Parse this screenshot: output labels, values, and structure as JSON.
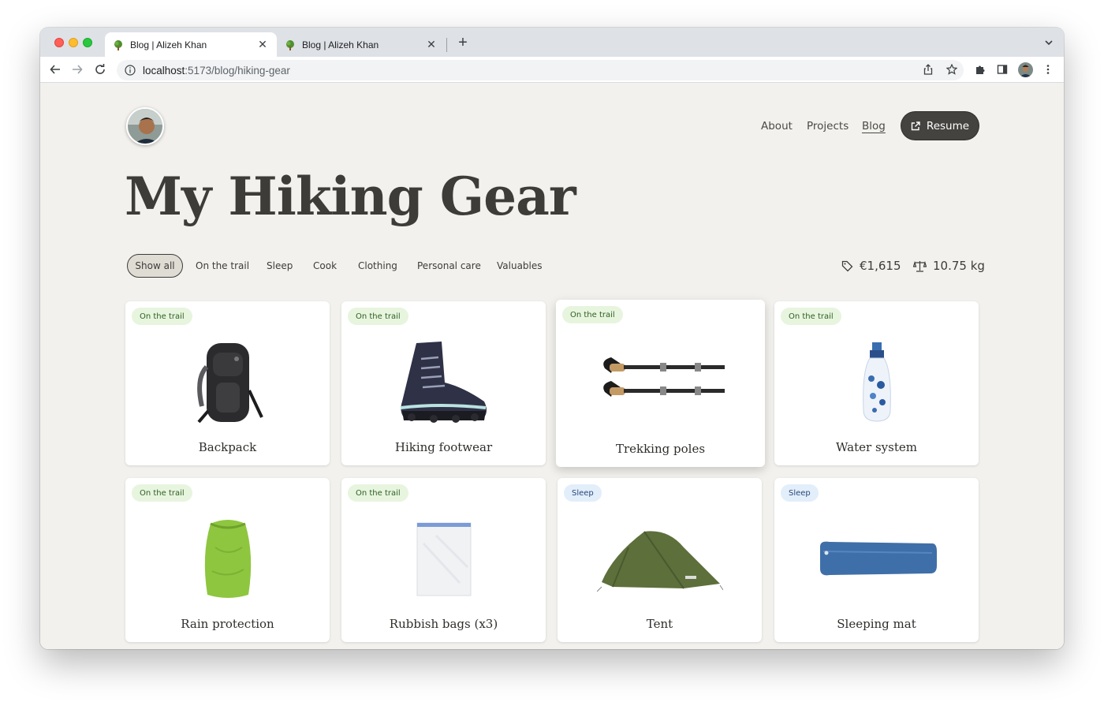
{
  "browser": {
    "tabs": [
      {
        "title": "Blog | Alizeh Khan",
        "active": true
      },
      {
        "title": "Blog | Alizeh Khan",
        "active": false
      }
    ],
    "url_host": "localhost",
    "url_path": ":5173/blog/hiking-gear"
  },
  "nav": {
    "items": [
      "About",
      "Projects",
      "Blog"
    ],
    "active": "Blog",
    "resume_label": "Resume"
  },
  "page_title": "My Hiking Gear",
  "filters": {
    "items": [
      "Show all",
      "On the trail",
      "Sleep",
      "Cook",
      "Clothing",
      "Personal care",
      "Valuables"
    ],
    "selected": "Show all"
  },
  "stats": {
    "price": "€1,615",
    "weight": "10.75 kg"
  },
  "gear": [
    {
      "name": "Backpack",
      "category": "On the trail",
      "icon": "backpack-image"
    },
    {
      "name": "Hiking footwear",
      "category": "On the trail",
      "icon": "hiking-boot-image"
    },
    {
      "name": "Trekking poles",
      "category": "On the trail",
      "icon": "trekking-poles-image"
    },
    {
      "name": "Water system",
      "category": "On the trail",
      "icon": "water-bottle-image"
    },
    {
      "name": "Rain protection",
      "category": "On the trail",
      "icon": "rain-cover-image"
    },
    {
      "name": "Rubbish bags (x3)",
      "category": "On the trail",
      "icon": "rubbish-bag-image"
    },
    {
      "name": "Tent",
      "category": "Sleep",
      "icon": "tent-image"
    },
    {
      "name": "Sleeping mat",
      "category": "Sleep",
      "icon": "sleeping-mat-image"
    }
  ],
  "colors": {
    "page_background": "#f2f1ed",
    "button_dark": "#44433f",
    "badge_trail_bg": "#e7f5df",
    "badge_sleep_bg": "#e3eefb"
  }
}
